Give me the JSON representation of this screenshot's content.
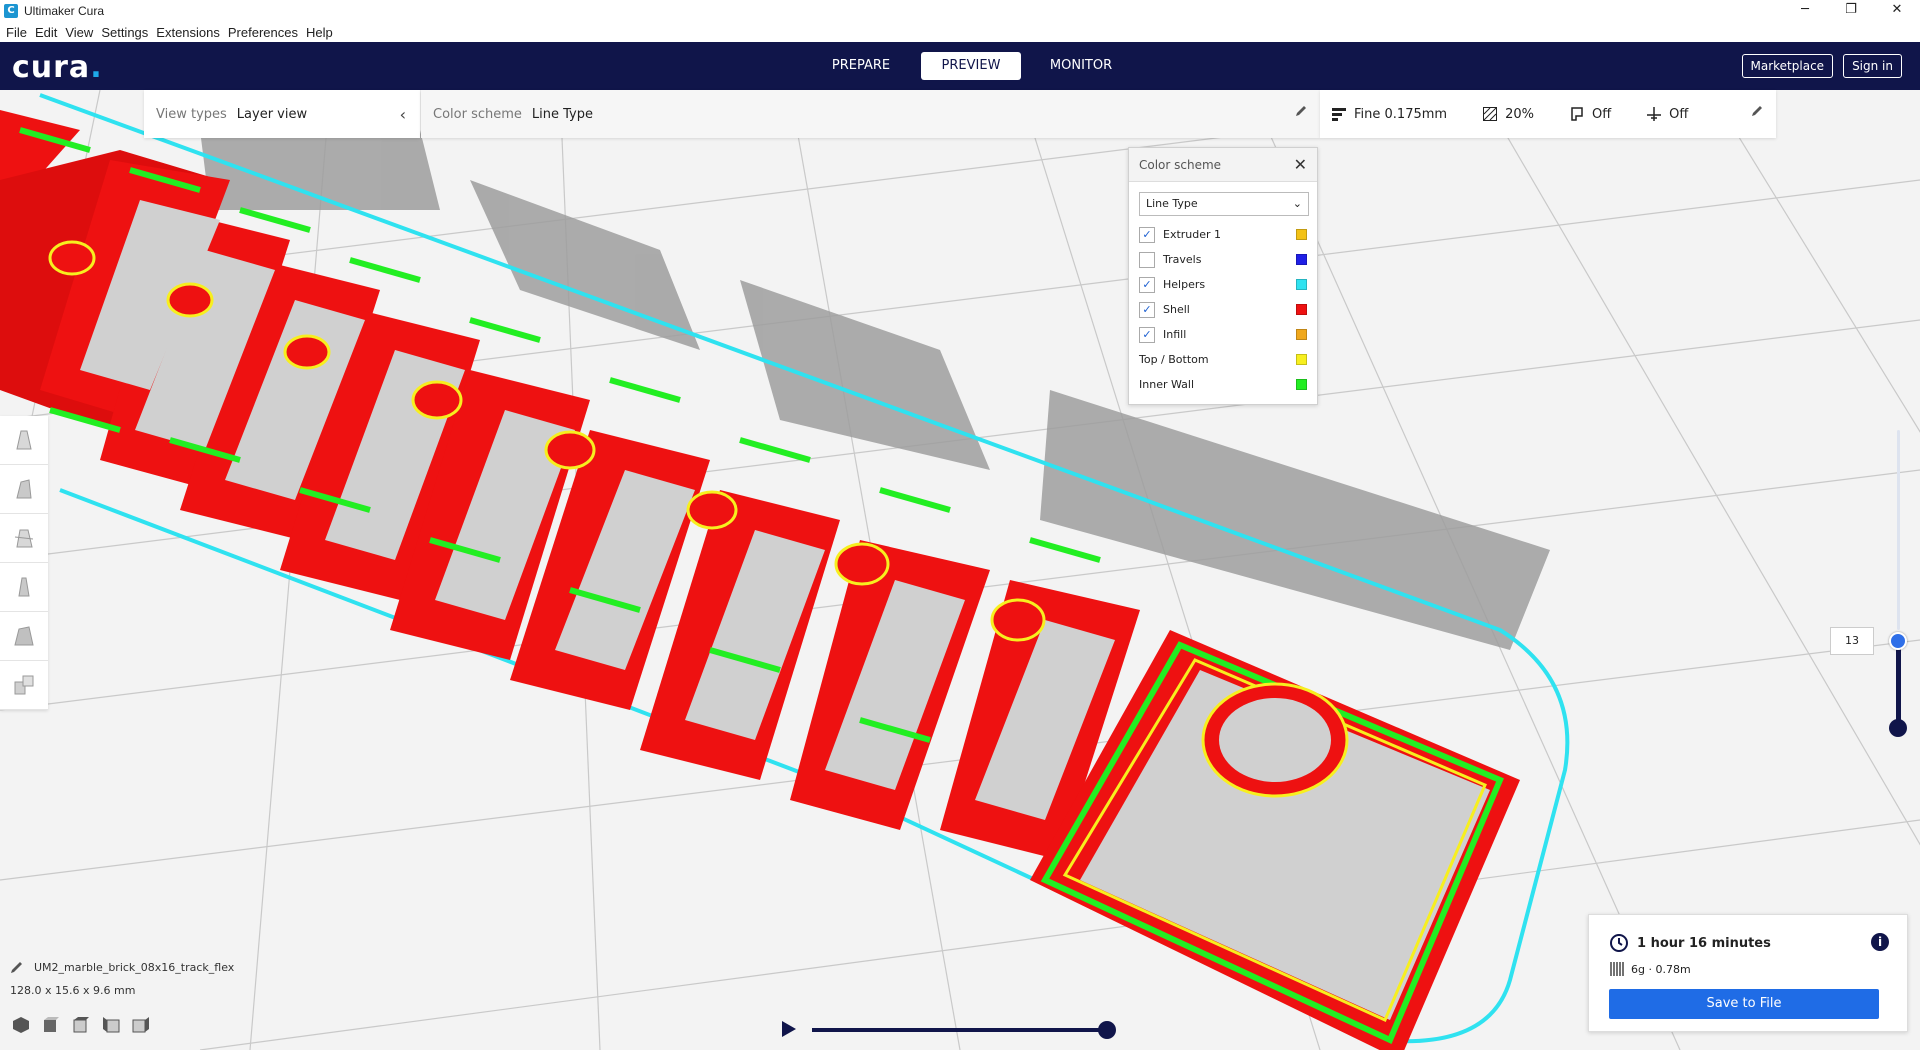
{
  "window": {
    "title": "Ultimaker Cura",
    "minimize": "─",
    "restore": "❐",
    "close": "✕"
  },
  "menu": [
    "File",
    "Edit",
    "View",
    "Settings",
    "Extensions",
    "Preferences",
    "Help"
  ],
  "header": {
    "logo_text": "cura",
    "logo_dot": ".",
    "stages": [
      {
        "label": "PREPARE",
        "active": false
      },
      {
        "label": "PREVIEW",
        "active": true
      },
      {
        "label": "MONITOR",
        "active": false
      }
    ],
    "marketplace_label": "Marketplace",
    "signin_label": "Sign in"
  },
  "view_type": {
    "label": "View types",
    "value": "Layer view"
  },
  "color_scheme_bar": {
    "label": "Color scheme",
    "value": "Line Type"
  },
  "print_settings": {
    "profile": "Fine 0.175mm",
    "infill": "20%",
    "support": "Off",
    "adhesion": "Off"
  },
  "color_scheme_popup": {
    "title": "Color scheme",
    "close": "✕",
    "selected": "Line Type",
    "items": [
      {
        "label": "Extruder 1",
        "checkbox": true,
        "checked": true,
        "color": "#f3c216"
      },
      {
        "label": "Travels",
        "checkbox": true,
        "checked": false,
        "color": "#1f1fe6"
      },
      {
        "label": "Helpers",
        "checkbox": true,
        "checked": true,
        "color": "#2fe2f0"
      },
      {
        "label": "Shell",
        "checkbox": true,
        "checked": true,
        "color": "#ee1111"
      },
      {
        "label": "Infill",
        "checkbox": true,
        "checked": true,
        "color": "#f0a81c"
      },
      {
        "label": "Top / Bottom",
        "checkbox": false,
        "checked": false,
        "color": "#f7ef1f"
      },
      {
        "label": "Inner Wall",
        "checkbox": false,
        "checked": false,
        "color": "#22ee22"
      }
    ]
  },
  "layer_slider": {
    "current_layer": "13"
  },
  "model": {
    "name": "UM2_marble_brick_08x16_track_flex",
    "dimensions": "128.0 x 15.6 x 9.6 mm"
  },
  "job": {
    "time": "1 hour 16 minutes",
    "material": "6g · 0.78m",
    "save_label": "Save to File",
    "info_glyph": "i"
  },
  "colors": {
    "header": "#10154a",
    "accent": "#1f6ce6",
    "shell": "#ee1111",
    "inner_wall": "#22ee22",
    "top_bottom": "#f7ef1f",
    "helpers": "#2fe2f0"
  }
}
